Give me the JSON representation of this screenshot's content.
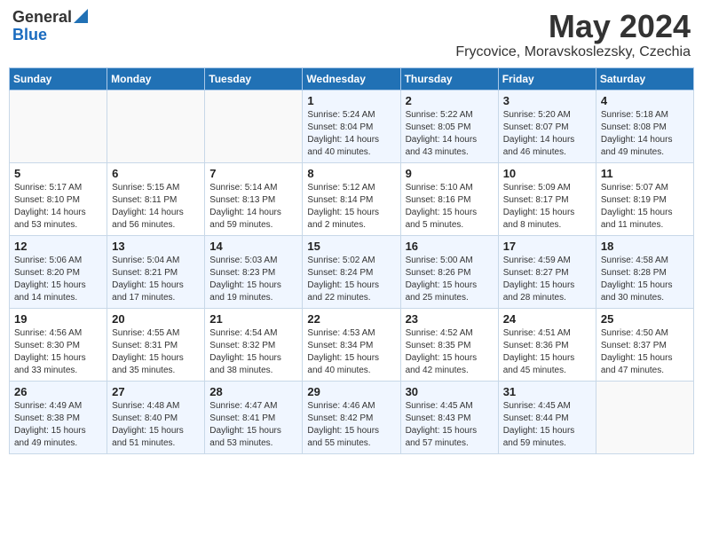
{
  "header": {
    "logo_general": "General",
    "logo_blue": "Blue",
    "title": "May 2024",
    "subtitle": "Frycovice, Moravskoslezsky, Czechia"
  },
  "days_of_week": [
    "Sunday",
    "Monday",
    "Tuesday",
    "Wednesday",
    "Thursday",
    "Friday",
    "Saturday"
  ],
  "weeks": [
    [
      {
        "num": "",
        "info": ""
      },
      {
        "num": "",
        "info": ""
      },
      {
        "num": "",
        "info": ""
      },
      {
        "num": "1",
        "info": "Sunrise: 5:24 AM\nSunset: 8:04 PM\nDaylight: 14 hours\nand 40 minutes."
      },
      {
        "num": "2",
        "info": "Sunrise: 5:22 AM\nSunset: 8:05 PM\nDaylight: 14 hours\nand 43 minutes."
      },
      {
        "num": "3",
        "info": "Sunrise: 5:20 AM\nSunset: 8:07 PM\nDaylight: 14 hours\nand 46 minutes."
      },
      {
        "num": "4",
        "info": "Sunrise: 5:18 AM\nSunset: 8:08 PM\nDaylight: 14 hours\nand 49 minutes."
      }
    ],
    [
      {
        "num": "5",
        "info": "Sunrise: 5:17 AM\nSunset: 8:10 PM\nDaylight: 14 hours\nand 53 minutes."
      },
      {
        "num": "6",
        "info": "Sunrise: 5:15 AM\nSunset: 8:11 PM\nDaylight: 14 hours\nand 56 minutes."
      },
      {
        "num": "7",
        "info": "Sunrise: 5:14 AM\nSunset: 8:13 PM\nDaylight: 14 hours\nand 59 minutes."
      },
      {
        "num": "8",
        "info": "Sunrise: 5:12 AM\nSunset: 8:14 PM\nDaylight: 15 hours\nand 2 minutes."
      },
      {
        "num": "9",
        "info": "Sunrise: 5:10 AM\nSunset: 8:16 PM\nDaylight: 15 hours\nand 5 minutes."
      },
      {
        "num": "10",
        "info": "Sunrise: 5:09 AM\nSunset: 8:17 PM\nDaylight: 15 hours\nand 8 minutes."
      },
      {
        "num": "11",
        "info": "Sunrise: 5:07 AM\nSunset: 8:19 PM\nDaylight: 15 hours\nand 11 minutes."
      }
    ],
    [
      {
        "num": "12",
        "info": "Sunrise: 5:06 AM\nSunset: 8:20 PM\nDaylight: 15 hours\nand 14 minutes."
      },
      {
        "num": "13",
        "info": "Sunrise: 5:04 AM\nSunset: 8:21 PM\nDaylight: 15 hours\nand 17 minutes."
      },
      {
        "num": "14",
        "info": "Sunrise: 5:03 AM\nSunset: 8:23 PM\nDaylight: 15 hours\nand 19 minutes."
      },
      {
        "num": "15",
        "info": "Sunrise: 5:02 AM\nSunset: 8:24 PM\nDaylight: 15 hours\nand 22 minutes."
      },
      {
        "num": "16",
        "info": "Sunrise: 5:00 AM\nSunset: 8:26 PM\nDaylight: 15 hours\nand 25 minutes."
      },
      {
        "num": "17",
        "info": "Sunrise: 4:59 AM\nSunset: 8:27 PM\nDaylight: 15 hours\nand 28 minutes."
      },
      {
        "num": "18",
        "info": "Sunrise: 4:58 AM\nSunset: 8:28 PM\nDaylight: 15 hours\nand 30 minutes."
      }
    ],
    [
      {
        "num": "19",
        "info": "Sunrise: 4:56 AM\nSunset: 8:30 PM\nDaylight: 15 hours\nand 33 minutes."
      },
      {
        "num": "20",
        "info": "Sunrise: 4:55 AM\nSunset: 8:31 PM\nDaylight: 15 hours\nand 35 minutes."
      },
      {
        "num": "21",
        "info": "Sunrise: 4:54 AM\nSunset: 8:32 PM\nDaylight: 15 hours\nand 38 minutes."
      },
      {
        "num": "22",
        "info": "Sunrise: 4:53 AM\nSunset: 8:34 PM\nDaylight: 15 hours\nand 40 minutes."
      },
      {
        "num": "23",
        "info": "Sunrise: 4:52 AM\nSunset: 8:35 PM\nDaylight: 15 hours\nand 42 minutes."
      },
      {
        "num": "24",
        "info": "Sunrise: 4:51 AM\nSunset: 8:36 PM\nDaylight: 15 hours\nand 45 minutes."
      },
      {
        "num": "25",
        "info": "Sunrise: 4:50 AM\nSunset: 8:37 PM\nDaylight: 15 hours\nand 47 minutes."
      }
    ],
    [
      {
        "num": "26",
        "info": "Sunrise: 4:49 AM\nSunset: 8:38 PM\nDaylight: 15 hours\nand 49 minutes."
      },
      {
        "num": "27",
        "info": "Sunrise: 4:48 AM\nSunset: 8:40 PM\nDaylight: 15 hours\nand 51 minutes."
      },
      {
        "num": "28",
        "info": "Sunrise: 4:47 AM\nSunset: 8:41 PM\nDaylight: 15 hours\nand 53 minutes."
      },
      {
        "num": "29",
        "info": "Sunrise: 4:46 AM\nSunset: 8:42 PM\nDaylight: 15 hours\nand 55 minutes."
      },
      {
        "num": "30",
        "info": "Sunrise: 4:45 AM\nSunset: 8:43 PM\nDaylight: 15 hours\nand 57 minutes."
      },
      {
        "num": "31",
        "info": "Sunrise: 4:45 AM\nSunset: 8:44 PM\nDaylight: 15 hours\nand 59 minutes."
      },
      {
        "num": "",
        "info": ""
      }
    ]
  ]
}
